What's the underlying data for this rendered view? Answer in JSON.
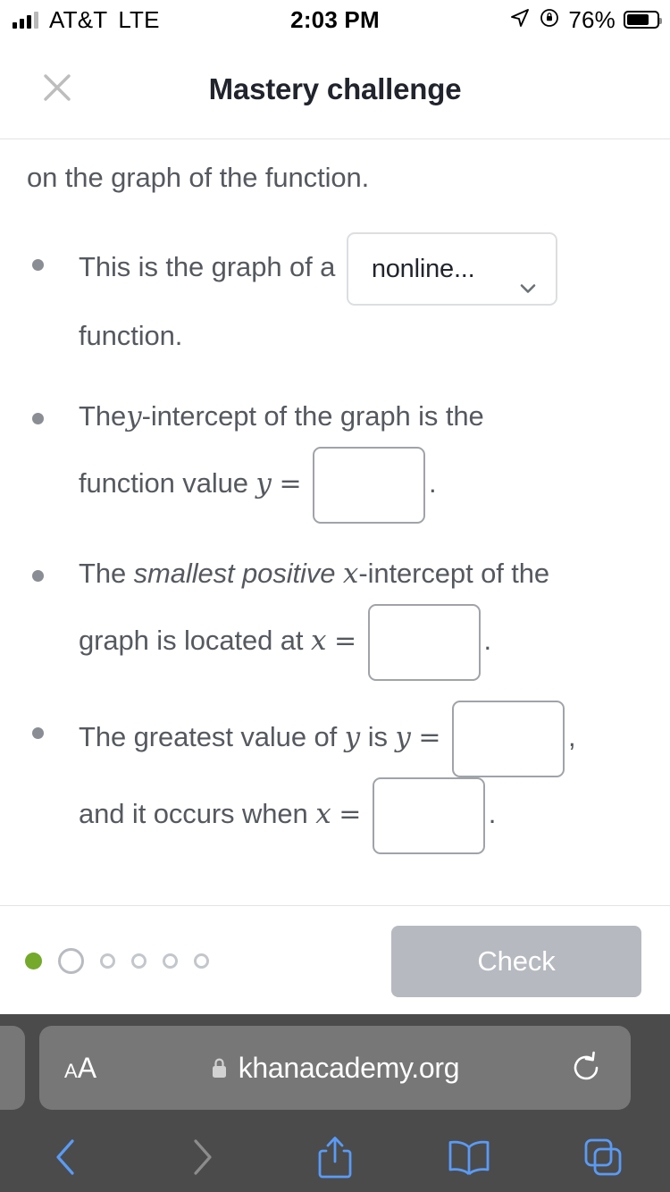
{
  "status_bar": {
    "carrier": "AT&T",
    "network": "LTE",
    "time": "2:03 PM",
    "battery_percent": "76%",
    "location_icon": "location-arrow-icon",
    "rotation_lock_icon": "rotation-lock-icon",
    "signal_icon": "signal-bars-icon",
    "battery_icon": "battery-icon"
  },
  "header": {
    "title": "Mastery challenge",
    "close_icon": "close-icon"
  },
  "exercise": {
    "prompt_clipped": "on the graph of the function.",
    "bullets": [
      {
        "id": "function-type",
        "text_before": "This is the graph of a",
        "dropdown_value": "nonline...",
        "dropdown_icon": "chevron-down-icon",
        "text_after": "function."
      },
      {
        "id": "y-intercept",
        "line1_a": "The",
        "line1_var": "y",
        "line1_b": "-intercept of the graph is the",
        "line2_a": "function value",
        "line2_var": "y",
        "line2_eq": "=",
        "input_value": "",
        "line2_end": "."
      },
      {
        "id": "smallest-positive-x-intercept",
        "line1_a": "The",
        "line1_emph": "smallest positive",
        "line1_var": "x",
        "line1_b": "-intercept of the",
        "line2_a": "graph is located at",
        "line2_var": "x",
        "line2_eq": "=",
        "input_value": "",
        "line2_end": "."
      },
      {
        "id": "greatest-value-of-y",
        "line1_a": "The greatest value of",
        "line1_var1": "y",
        "line1_mid": "is",
        "line1_var2": "y",
        "line1_eq": "=",
        "input1_value": "",
        "line1_end": ",",
        "line2_a": "and it occurs when",
        "line2_var": "x",
        "line2_eq": "=",
        "input2_value": "",
        "line2_end": "."
      }
    ]
  },
  "footer": {
    "check_label": "Check",
    "check_enabled": false,
    "progress": {
      "total": 6,
      "completed": 1,
      "current_index": 1,
      "completed_color": "#74a92c",
      "pending_color": "#c3c6ca"
    }
  },
  "browser": {
    "text_size_label_small": "A",
    "text_size_label_large": "A",
    "lock_icon": "lock-icon",
    "url": "khanacademy.org",
    "reload_icon": "reload-icon",
    "toolbar": [
      {
        "name": "back-button",
        "icon": "chevron-left-icon",
        "enabled": true
      },
      {
        "name": "forward-button",
        "icon": "chevron-right-icon",
        "enabled": false
      },
      {
        "name": "share-button",
        "icon": "share-icon",
        "enabled": true
      },
      {
        "name": "bookmarks-button",
        "icon": "book-icon",
        "enabled": true
      },
      {
        "name": "tabs-button",
        "icon": "tabs-icon",
        "enabled": true
      }
    ],
    "accent_color": "#5a9bf6",
    "disabled_color": "#8c8c8c"
  }
}
